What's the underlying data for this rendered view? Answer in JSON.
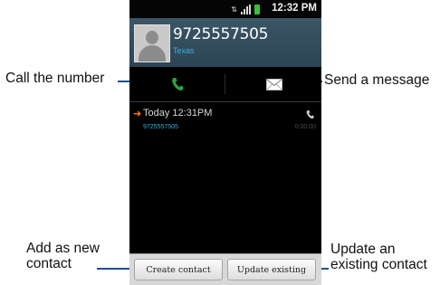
{
  "status_bar": {
    "time": "12:32 PM"
  },
  "contact": {
    "number": "9725557505",
    "location": "Texas"
  },
  "call_log": [
    {
      "direction": "outgoing",
      "date": "Today 12:31PM",
      "number": "9725557505",
      "duration": "0:00:00"
    }
  ],
  "buttons": {
    "create_contact": "Create contact",
    "update_existing": "Update existing"
  },
  "callouts": {
    "call": "Call the number",
    "message": "Send a message",
    "add_line1": "Add as new",
    "add_line2": "contact",
    "update_line1": "Update an",
    "update_line2": "existing contact"
  },
  "colors": {
    "accent_blue": "#3ab0d8",
    "call_green": "#2ea043",
    "outgoing_orange": "#ff7a00",
    "callout_line": "#1f4f8f"
  },
  "icons": {
    "call": "phone-icon",
    "message": "envelope-icon",
    "avatar": "default-contact-icon"
  }
}
